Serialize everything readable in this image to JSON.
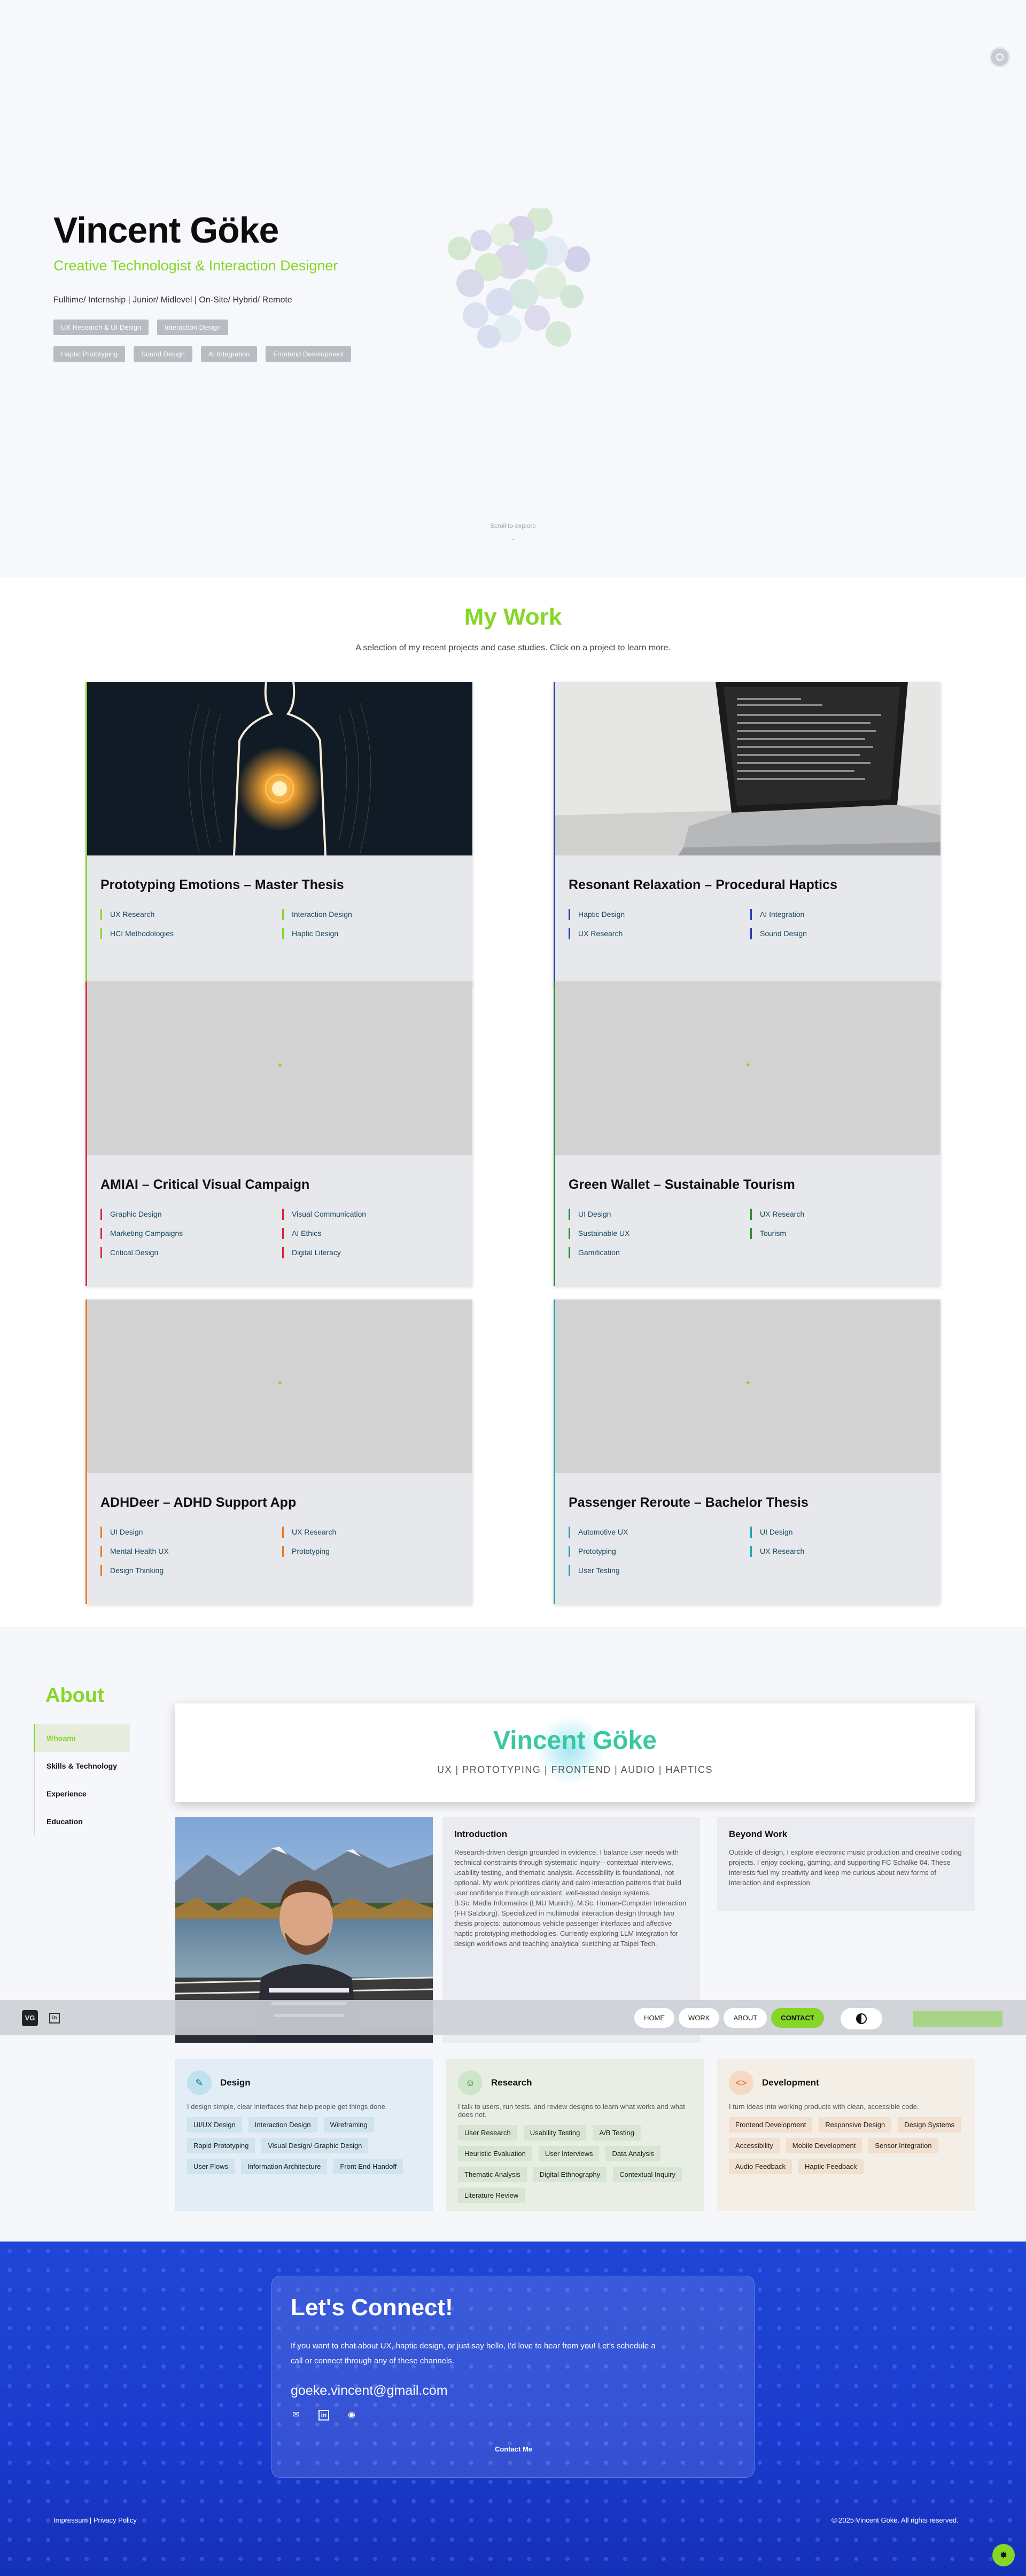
{
  "hero": {
    "name": "Vincent Göke",
    "role": "Creative Technologist & Interaction Designer",
    "availability": "Fulltime/ Internship | Junior/ Midlevel | On-Site/ Hybrid/ Remote",
    "chips_row1": [
      "UX Research & UI Design",
      "Interaction Design"
    ],
    "chips_row2": [
      "Haptic Prototyping",
      "Sound Design",
      "AI Integration",
      "Frontend Development"
    ],
    "scroll_hint": "Scroll to explore",
    "scroll_icon": "chevron-down-icon"
  },
  "work": {
    "title": "My Work",
    "subtitle": "A selection of my recent projects and case studies. Click on a project to learn more.",
    "projects": [
      {
        "title": "Prototyping Emotions – Master Thesis",
        "accent": "#86d627",
        "tags": [
          "UX Research",
          "Interaction Design",
          "HCI Methodologies",
          "Haptic Design"
        ]
      },
      {
        "title": "Resonant Relaxation – Procedural Haptics",
        "accent": "#2b3fb5",
        "tags": [
          "Haptic Design",
          "AI Integration",
          "UX Research",
          "Sound Design"
        ]
      },
      {
        "title": "AMIAI – Critical Visual Campaign",
        "accent": "#d62839",
        "tags": [
          "Graphic Design",
          "Visual Communication",
          "Marketing Campaigns",
          "AI Ethics",
          "Critical Design",
          "Digital Literacy"
        ]
      },
      {
        "title": "Green Wallet – Sustainable Tourism",
        "accent": "#2e8b3a",
        "tags": [
          "UI Design",
          "UX Research",
          "Sustainable UX",
          "Tourism",
          "Gamification"
        ]
      },
      {
        "title": "ADHDeer – ADHD Support App",
        "accent": "#e67a22",
        "tags": [
          "UI Design",
          "UX Research",
          "Mental Health UX",
          "Prototyping",
          "Design Thinking"
        ]
      },
      {
        "title": "Passenger Reroute – Bachelor Thesis",
        "accent": "#22a6b3",
        "tags": [
          "Automotive UX",
          "UI Design",
          "Prototyping",
          "UX Research",
          "User Testing"
        ]
      }
    ]
  },
  "about": {
    "title": "About",
    "nav": [
      "Whoami",
      "Skills & Technology",
      "Experience",
      "Education"
    ],
    "banner_name": "Vincent Göke",
    "banner_sub": "UX | PROTOTYPING | FRONTEND | AUDIO | HAPTICS",
    "intro_title": "Introduction",
    "intro_text": "Research-driven design grounded in evidence. I balance user needs with technical constraints through systematic inquiry—contextual interviews, usability testing, and thematic analysis. Accessibility is foundational, not optional. My work prioritizes clarity and calm interaction patterns that build user confidence through consistent, well-tested design systems.",
    "intro_text2": "B.Sc. Media Informatics (LMU Munich), M.Sc. Human-Computer Interaction (FH Salzburg). Specialized in multimodal interaction design through two thesis projects: autonomous vehicle passenger interfaces and affective haptic prototyping methodologies. Currently exploring LLM integration for design workflows and teaching analytical sketching at Taipei Tech.",
    "beyond_title": "Beyond Work",
    "beyond_text": "Outside of design, I explore electronic music production and creative coding projects. I enjoy cooking, gaming, and supporting FC Schalke 04. These interests fuel my creativity and keep me curious about new forms of interaction and expression.",
    "skills": [
      {
        "title": "Design",
        "icon": "pen-icon",
        "text": "I design simple, clear interfaces that help people get things done.",
        "pills": [
          "UI/UX Design",
          "Interaction Design",
          "Wireframing",
          "Rapid Prototyping",
          "Visual Design/ Graphic Design",
          "User Flows",
          "Information Architecture",
          "Front End Handoff"
        ]
      },
      {
        "title": "Research",
        "icon": "person-icon",
        "text": "I talk to users, run tests, and review designs to learn what works and what does not.",
        "pills": [
          "User Research",
          "Usability Testing",
          "A/B Testing",
          "Heuristic Evaluation",
          "User Interviews",
          "Data Analysis",
          "Thematic Analysis",
          "Digital Ethnography",
          "Contextual Inquiry",
          "Literature Review"
        ]
      },
      {
        "title": "Development",
        "icon": "code-icon",
        "text": "I turn ideas into working products with clean, accessible code.",
        "pills": [
          "Frontend Development",
          "Responsive Design",
          "Design Systems",
          "Accessibility",
          "Mobile Development",
          "Sensor Integration",
          "Audio Feedback",
          "Haptic Feedback"
        ]
      }
    ]
  },
  "navbar": {
    "logo": "VG",
    "linkedin_icon": "linkedin-icon",
    "items": [
      "HOME",
      "WORK",
      "ABOUT",
      "CONTACT"
    ],
    "theme_icon": "theme-toggle-icon"
  },
  "contact": {
    "title": "Let's Connect!",
    "text": "If you want to chat about UX, haptic design, or just say hello, I'd love to hear from you! Let's schedule a call or connect through any of these channels.",
    "email": "goeke.vincent@gmail.com",
    "icons": [
      "mail-icon",
      "linkedin-icon",
      "github-icon"
    ],
    "button": "Contact Me",
    "footer_left": "Impressum | Privacy Policy",
    "footer_right": "© 2025 Vincent Göke. All rights reserved."
  }
}
